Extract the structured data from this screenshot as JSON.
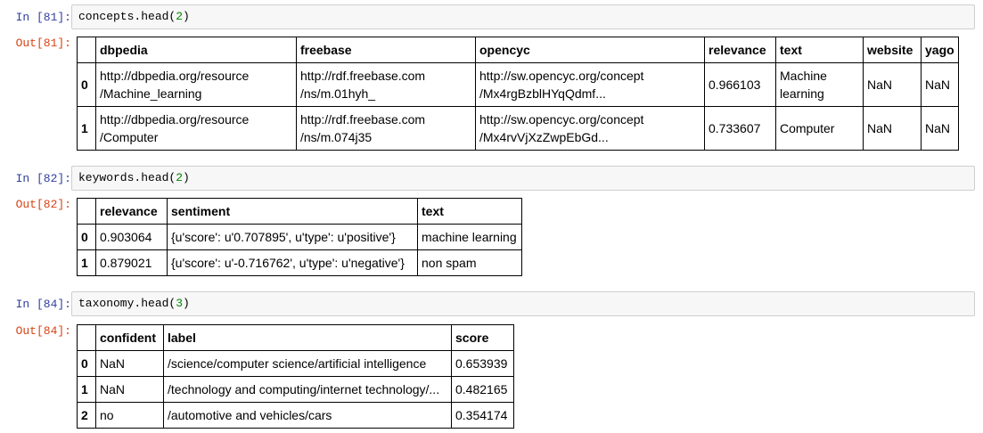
{
  "cells": [
    {
      "in_prompt": "In [81]:",
      "code_obj": "concepts.head(",
      "code_arg": "2",
      "code_end": ")",
      "out_prompt": "Out[81]:",
      "columns": [
        "",
        "dbpedia",
        "freebase",
        "opencyc",
        "relevance",
        "text",
        "website",
        "yago"
      ],
      "rows": [
        {
          "index": "0",
          "dbpedia": [
            "http://dbpedia.org/resource",
            "/Machine_learning"
          ],
          "freebase": [
            "http://rdf.freebase.com",
            "/ns/m.01hyh_"
          ],
          "opencyc": [
            "http://sw.opencyc.org/concept",
            "/Mx4rgBzblHYqQdmf..."
          ],
          "relevance": "0.966103",
          "text": [
            "Machine",
            "learning"
          ],
          "website": "NaN",
          "yago": "NaN"
        },
        {
          "index": "1",
          "dbpedia": [
            "http://dbpedia.org/resource",
            "/Computer"
          ],
          "freebase": [
            "http://rdf.freebase.com",
            "/ns/m.074j35"
          ],
          "opencyc": [
            "http://sw.opencyc.org/concept",
            "/Mx4rvVjXzZwpEbGd..."
          ],
          "relevance": "0.733607",
          "text": [
            "Computer"
          ],
          "website": "NaN",
          "yago": "NaN"
        }
      ]
    },
    {
      "in_prompt": "In [82]:",
      "code_obj": "keywords.head(",
      "code_arg": "2",
      "code_end": ")",
      "out_prompt": "Out[82]:",
      "columns": [
        "",
        "relevance",
        "sentiment",
        "text"
      ],
      "rows": [
        {
          "index": "0",
          "relevance": "0.903064",
          "sentiment": "{u'score': u'0.707895', u'type': u'positive'}",
          "text": "machine learning"
        },
        {
          "index": "1",
          "relevance": "0.879021",
          "sentiment": "{u'score': u'-0.716762', u'type': u'negative'}",
          "text": "non spam"
        }
      ]
    },
    {
      "in_prompt": "In [84]:",
      "code_obj": "taxonomy.head(",
      "code_arg": "3",
      "code_end": ")",
      "out_prompt": "Out[84]:",
      "columns": [
        "",
        "confident",
        "label",
        "score"
      ],
      "rows": [
        {
          "index": "0",
          "confident": "NaN",
          "label": "/science/computer science/artificial intelligence",
          "score": "0.653939"
        },
        {
          "index": "1",
          "confident": "NaN",
          "label": "/technology and computing/internet technology/...",
          "score": "0.482165"
        },
        {
          "index": "2",
          "confident": "no",
          "label": "/automotive and vehicles/cars",
          "score": "0.354174"
        }
      ]
    }
  ]
}
